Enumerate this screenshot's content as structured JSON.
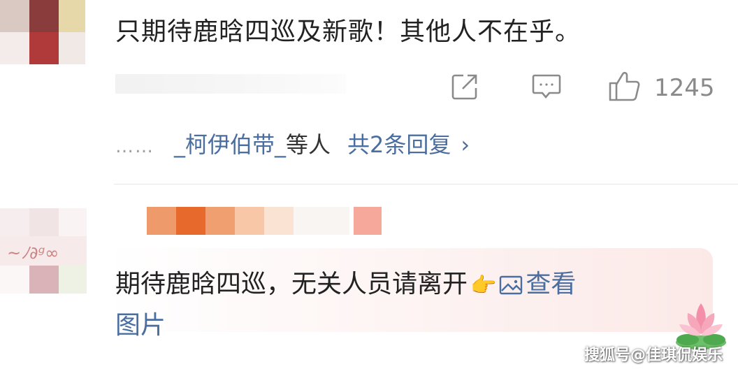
{
  "comments": [
    {
      "text": "只期待鹿晗四巡及新歌！其他人不在乎。",
      "like_count": "1245",
      "replies": {
        "dots": "……",
        "names": "_柯伊伯带_",
        "suffix": "等人",
        "count_text": "共2条回复",
        "chevron": "›"
      }
    },
    {
      "text_line1": "期待鹿晗四巡，无关人员请离开",
      "view_image_line1": "查看",
      "view_image_line2": "图片"
    }
  ],
  "icons": {
    "share": "share-icon",
    "comment": "comment-icon",
    "like": "thumbs-up-icon",
    "image": "image-icon",
    "hand_emoji": "pointing-hand-emoji",
    "lotus": "lotus-icon"
  },
  "watermark": "搜狐号@佳琪侃娱乐",
  "colors": {
    "link": "#4a6ea0",
    "text": "#222222",
    "muted": "#8a8a8a"
  }
}
